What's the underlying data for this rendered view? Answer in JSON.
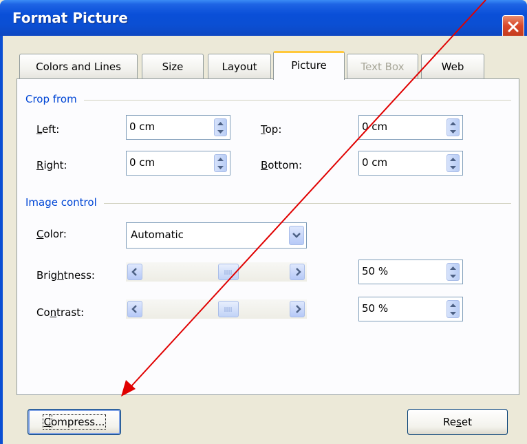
{
  "window": {
    "title": "Format Picture"
  },
  "tabs": [
    {
      "label": "Colors and Lines",
      "state": "normal"
    },
    {
      "label": "Size",
      "state": "normal"
    },
    {
      "label": "Layout",
      "state": "normal"
    },
    {
      "label": "Picture",
      "state": "active"
    },
    {
      "label": "Text Box",
      "state": "disabled"
    },
    {
      "label": "Web",
      "state": "normal"
    }
  ],
  "crop": {
    "section_label": "Crop from",
    "left": {
      "label_key": "L",
      "label_rest": "eft:",
      "value": "0 cm"
    },
    "top": {
      "label_key": "T",
      "label_rest": "op:",
      "value": "0 cm"
    },
    "right": {
      "label_key": "R",
      "label_rest": "ight:",
      "value": "0 cm"
    },
    "bottom": {
      "label_key": "B",
      "label_rest": "ottom:",
      "value": "0 cm"
    }
  },
  "image_control": {
    "section_label": "Image control",
    "color": {
      "label_key": "C",
      "label_rest": "olor:",
      "value": "Automatic"
    },
    "brightness": {
      "label_pre": "Brig",
      "label_key": "h",
      "label_rest": "tness:",
      "value": "50 %",
      "level_percent": 50
    },
    "contrast": {
      "label_pre": "Co",
      "label_key": "n",
      "label_rest": "trast:",
      "value": "50 %",
      "level_percent": 50
    }
  },
  "buttons": {
    "compress": {
      "label_key": "C",
      "label_rest": "ompress..."
    },
    "reset": {
      "label_pre": "Re",
      "label_key": "s",
      "label_rest": "et"
    }
  },
  "colors": {
    "titlebar": "#0b4fd3",
    "section_label": "#0046d5",
    "active_tab_accent": "#ffc83c",
    "annotation_arrow": "#e00000"
  }
}
